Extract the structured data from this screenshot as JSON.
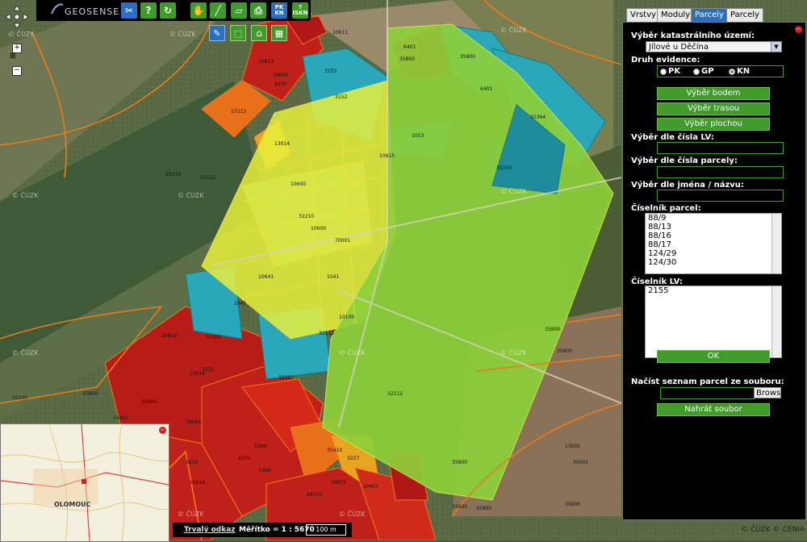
{
  "app": {
    "brand": "GEOSENSE"
  },
  "toolbar": {
    "tools": [
      {
        "name": "tools-icon",
        "glyph": "✂"
      },
      {
        "name": "help-icon",
        "glyph": "?"
      },
      {
        "name": "refresh-icon",
        "glyph": "↻"
      },
      {
        "name": "pan-hand-icon",
        "glyph": "✋"
      },
      {
        "name": "measure-line-icon",
        "glyph": "╱"
      },
      {
        "name": "measure-area-icon",
        "glyph": "▱"
      },
      {
        "name": "print-icon",
        "glyph": "⎙"
      },
      {
        "name": "pk-kn-icon",
        "text": "PK KN"
      },
      {
        "name": "iskn-icon",
        "text": "? ISKN"
      }
    ],
    "subtools": [
      {
        "name": "select-parcel-icon",
        "glyph": "✎"
      },
      {
        "name": "edit-polygon-icon",
        "glyph": "⬚"
      },
      {
        "name": "home-icon",
        "glyph": "⌂"
      },
      {
        "name": "grid-icon",
        "glyph": "▦"
      }
    ]
  },
  "map_controls": {
    "zoom_in": "+",
    "zoom_out": "−"
  },
  "tabs": [
    "Vrstvy",
    "Moduly",
    "Parcely",
    "Parcely"
  ],
  "active_tab": 2,
  "panel": {
    "cadastral_label": "Výběr katastrálního území:",
    "cadastral_value": "Jílové u Děčína",
    "evidence_label": "Druh evidence:",
    "evidence_options": [
      "PK",
      "GP",
      "KN"
    ],
    "evidence_selected": "KN",
    "btn_point": "Výběr bodem",
    "btn_route": "Výběr trasou",
    "btn_area": "Výběr plochou",
    "lv_label": "Výběr dle čísla LV:",
    "parcel_label": "Výběr dle čísla parcely:",
    "name_label": "Výběr dle jména / názvu:",
    "parcel_list_label": "Číselník parcel:",
    "parcel_list": [
      "88/9",
      "88/13",
      "88/16",
      "88/17",
      "124/29",
      "124/30"
    ],
    "lv_list_label": "Číselník LV:",
    "lv_list": [
      "2155"
    ],
    "ok_label": "OK",
    "file_label": "Načíst seznam parcel ze souboru:",
    "browse_label": "Browse",
    "upload_label": "Nahrát soubor"
  },
  "status": {
    "permalink": "Trvalý odkaz",
    "scale_text": "Měřítko = 1 : 5670",
    "scale_bar": "100 m"
  },
  "copyright": "© ČÚZK © CENIA",
  "watermark": "© ČÚZK",
  "minimap": {
    "city_label": "OLOMOUC"
  },
  "parcel_labels": [
    "10611",
    "35800",
    "6401",
    "35800",
    "10613",
    "10600",
    "3152",
    "17213",
    "8150",
    "3152",
    "32210",
    "13014",
    "1053",
    "35364",
    "10615",
    "35800",
    "32112",
    "31302",
    "10600",
    "70001",
    "10641",
    "1041",
    "1041",
    "32210",
    "20650",
    "13014",
    "6401",
    "32210",
    "35800",
    "10100",
    "7031",
    "35800",
    "10600",
    "32112",
    "35300",
    "35800",
    "15403",
    "19564",
    "22466",
    "3233",
    "10616",
    "4765",
    "7366",
    "5360",
    "10672",
    "10457",
    "3227",
    "35600",
    "35401",
    "13005",
    "35410",
    "24310",
    "35800",
    "35800",
    "35800",
    "10100",
    "32112"
  ],
  "colors": {
    "accent": "#2b6fc0",
    "button_green": "#3f9b2a",
    "parcel_green": "#8ccf3a",
    "parcel_yellow": "#e6f03c",
    "parcel_cyan": "#2aa7b8",
    "parcel_red": "#c0201a",
    "parcel_orange": "#e8701a",
    "boundary_orange": "#f07a18"
  }
}
